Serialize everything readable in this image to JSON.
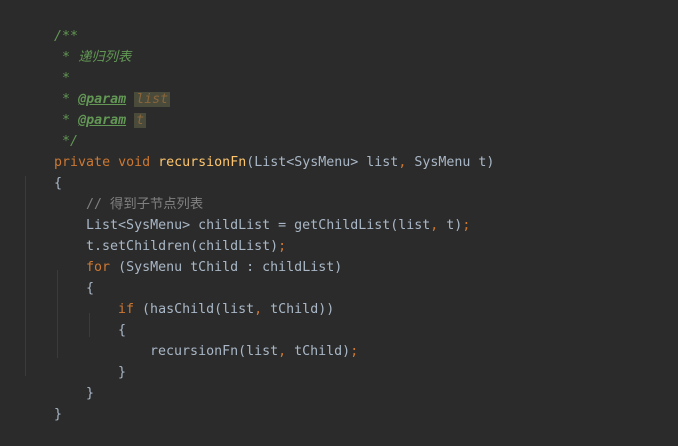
{
  "code": {
    "l1": {
      "open": "/**"
    },
    "l2": {
      "star": " * ",
      "text": "递归列表"
    },
    "l3": {
      "star": " *"
    },
    "l4": {
      "star": " * ",
      "tag": "@param",
      "name": "list"
    },
    "l5": {
      "star": " * ",
      "tag": "@param",
      "name": "t"
    },
    "l6": {
      "close": " */"
    },
    "l7": {
      "mod": "private",
      "void": "void",
      "method": "recursionFn",
      "p1": "(List<SysMenu> list",
      "comma": ",",
      "p2": " SysMenu t)"
    },
    "l8": {
      "brace": "{"
    },
    "l9": {
      "comment": "// 得到子节点列表"
    },
    "l10": {
      "a": "List<SysMenu> childList = getChildList(list",
      "comma": ",",
      "b": " t)",
      "semi": ";"
    },
    "l11": {
      "a": "t.setChildren(childList)",
      "semi": ";"
    },
    "l12": {
      "kw": "for",
      "rest": " (SysMenu tChild : childList)"
    },
    "l13": {
      "brace": "{"
    },
    "l14": {
      "kw": "if",
      "a": " (hasChild(list",
      "comma": ",",
      "b": " tChild))"
    },
    "l15": {
      "brace": "{"
    },
    "l16": {
      "a": "recursionFn(list",
      "comma": ",",
      "b": " tChild)",
      "semi": ";"
    },
    "l17": {
      "brace": "}"
    },
    "l18": {
      "brace": "}"
    },
    "l19": {
      "brace": "}"
    }
  }
}
